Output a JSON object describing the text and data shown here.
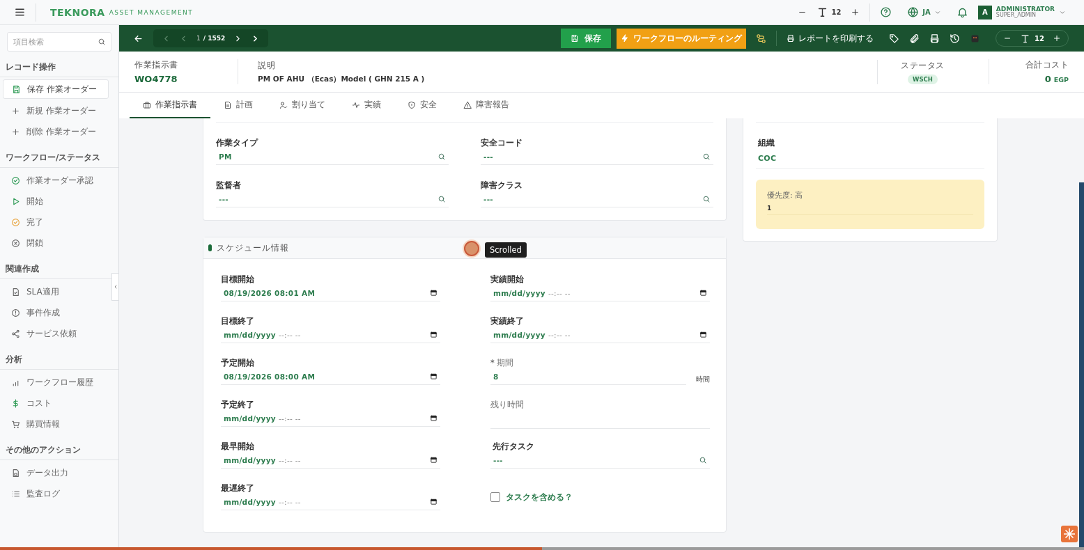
{
  "top_bar": {
    "logo": {
      "brand": "TEKNORA",
      "tagline": "ASSET MANAGEMENT"
    },
    "font_size": "12",
    "language": "JA",
    "user": {
      "initial": "A",
      "name": "ADMINISTRATOR",
      "role": "SUPER_ADMIN"
    }
  },
  "sidebar": {
    "search": {
      "placeholder": "項目検索"
    },
    "sections": [
      {
        "title": "レコード操作",
        "items": [
          {
            "label": "保存 作業オーダー",
            "selected": true
          },
          {
            "label": "新規 作業オーダー",
            "selected": false
          },
          {
            "label": "削除 作業オーダー",
            "selected": false
          }
        ]
      },
      {
        "title": "ワークフロー/ステータス",
        "items": [
          {
            "label": "作業オーダー承認",
            "selected": false
          },
          {
            "label": "開始",
            "selected": false
          },
          {
            "label": "完了",
            "selected": false
          },
          {
            "label": "閉鎖",
            "selected": false
          }
        ]
      },
      {
        "title": "関連作成",
        "items": [
          {
            "label": "SLA適用",
            "selected": false
          },
          {
            "label": "事件作成",
            "selected": false
          },
          {
            "label": "サービス依頼",
            "selected": false
          }
        ]
      },
      {
        "title": "分析",
        "items": [
          {
            "label": "ワークフロー履歴",
            "selected": false
          },
          {
            "label": "コスト",
            "selected": false
          },
          {
            "label": "購買情報",
            "selected": false
          }
        ]
      },
      {
        "title": "その他のアクション",
        "items": [
          {
            "label": "データ出力",
            "selected": false
          },
          {
            "label": "監査ログ",
            "selected": false
          }
        ]
      }
    ]
  },
  "toolbar": {
    "pager": {
      "current": "1",
      "total": "/ 1552",
      "prev_disabled": true
    },
    "save": "保存",
    "workflow": "ワークフローのルーティング",
    "print_report": "レポートを印刷する",
    "font_size": "12"
  },
  "header": {
    "fields": [
      {
        "kind": "id",
        "label": "作業指示書",
        "value": "WO4778"
      },
      {
        "kind": "text",
        "label": "説明",
        "value": "PM OF AHU （Ecas）Model ( GHN 215 A )"
      },
      {
        "kind": "badge",
        "label": "ステータス",
        "value": "WSCH"
      },
      {
        "kind": "cost",
        "label": "合計コスト",
        "value": "0",
        "unit": "EGP"
      }
    ]
  },
  "tabs": [
    {
      "label": "作業指示書",
      "selected": true
    },
    {
      "label": "計画",
      "selected": false
    },
    {
      "label": "割り当て",
      "selected": false
    },
    {
      "label": "実績",
      "selected": false
    },
    {
      "label": "安全",
      "selected": false
    },
    {
      "label": "障害報告",
      "selected": false
    }
  ],
  "general_card": {
    "fields": [
      {
        "label": "作業タイプ",
        "value": "PM"
      },
      {
        "label": "安全コード",
        "value": "---"
      },
      {
        "label": "監督者",
        "value": "---"
      },
      {
        "label": "障害クラス",
        "value": "---"
      }
    ]
  },
  "side_card": {
    "fields": [
      {
        "label": "組織",
        "value": "COC"
      }
    ],
    "priority": {
      "label": "優先度: 高",
      "value": "1"
    }
  },
  "schedule": {
    "title": "スケジュール情報",
    "left": [
      {
        "kind": "date",
        "label": "目標開始",
        "value": "08/19/2026 08:01 AM"
      },
      {
        "kind": "date",
        "label": "目標終了",
        "value": "mm/dd/yyyy",
        "time_hint": "--:-- --"
      },
      {
        "kind": "date",
        "label": "予定開始",
        "value": "08/19/2026 08:00 AM"
      },
      {
        "kind": "date",
        "label": "予定終了",
        "value": "mm/dd/yyyy",
        "time_hint": "--:-- --"
      },
      {
        "kind": "date",
        "label": "最早開始",
        "value": "mm/dd/yyyy",
        "time_hint": "--:-- --"
      },
      {
        "kind": "date",
        "label": "最遅終了",
        "value": "mm/dd/yyyy",
        "time_hint": "--:-- --"
      }
    ],
    "right": [
      {
        "kind": "date",
        "label": "実績開始",
        "value": "mm/dd/yyyy",
        "time_hint": "--:-- --"
      },
      {
        "kind": "date",
        "label": "実績終了",
        "value": "mm/dd/yyyy",
        "time_hint": "--:-- --"
      },
      {
        "kind": "number",
        "label": "期間",
        "required_mark": "*",
        "value": "8",
        "unit": "時間"
      },
      {
        "kind": "text",
        "label": "残り時間"
      },
      {
        "kind": "lookup",
        "label": "先行タスク",
        "value": "---"
      },
      {
        "kind": "checkbox",
        "label": "タスクを含める？",
        "checked": false
      }
    ]
  },
  "overlay": {
    "tooltip": "Scrolled",
    "progress": {
      "level": 0.5
    }
  }
}
